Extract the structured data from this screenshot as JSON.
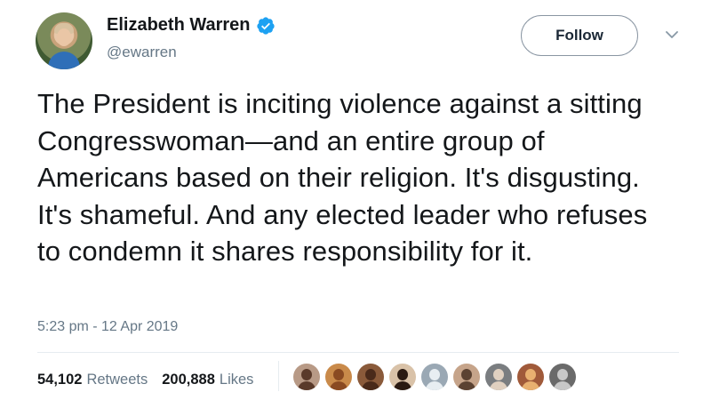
{
  "user": {
    "name": "Elizabeth Warren",
    "handle": "@ewarren"
  },
  "follow_label": "Follow",
  "tweet": {
    "text": "The President is inciting violence against a sitting Congresswoman—and an entire group of Americans based on their religion. It's disgusting. It's shameful. And any elected leader who refuses to condemn it shares responsibility for it.",
    "time": "5:23 pm - 12 Apr 2019"
  },
  "stats": {
    "retweets_count": "54,102",
    "retweets_label": "Retweets",
    "likes_count": "200,888",
    "likes_label": "Likes"
  },
  "colors": {
    "verified": "#1da1f2",
    "secondary_text": "#657786"
  },
  "liker_avatars": [
    {
      "name": "liker-1",
      "bg": "#b89a86",
      "fg": "#5a3a2a"
    },
    {
      "name": "liker-2",
      "bg": "#c98a4a",
      "fg": "#8a4a22"
    },
    {
      "name": "liker-3",
      "bg": "#8a5a3a",
      "fg": "#4a2a1a"
    },
    {
      "name": "liker-4",
      "bg": "#d9c2a8",
      "fg": "#2a1a12"
    },
    {
      "name": "liker-5",
      "bg": "#9aa8b4",
      "fg": "#e8eef2"
    },
    {
      "name": "liker-6",
      "bg": "#c6a48a",
      "fg": "#5b4232"
    },
    {
      "name": "liker-7",
      "bg": "#7a7d80",
      "fg": "#e0d0c0"
    },
    {
      "name": "liker-8",
      "bg": "#a05a3a",
      "fg": "#e8b070"
    },
    {
      "name": "liker-9",
      "bg": "#6a6a6a",
      "fg": "#c8c8c8"
    }
  ]
}
